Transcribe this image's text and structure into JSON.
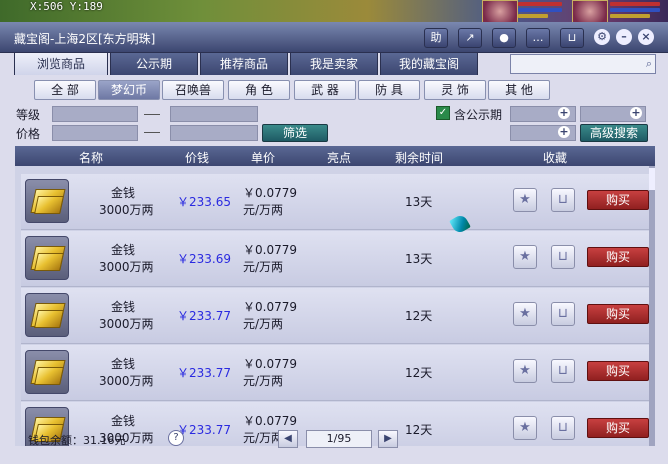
{
  "game_hud": {
    "coords": "X:506 Y:189"
  },
  "window": {
    "title": "藏宝阁-上海2区[东方明珠]",
    "title_buttons": [
      "助",
      "↗"
    ]
  },
  "tabs": [
    {
      "label": "浏览商品",
      "active": true
    },
    {
      "label": "公示期",
      "active": false
    },
    {
      "label": "推荐商品",
      "active": false
    },
    {
      "label": "我是卖家",
      "active": false
    },
    {
      "label": "我的藏宝阁",
      "active": false
    }
  ],
  "search": {
    "value": "",
    "placeholder": ""
  },
  "categories": [
    {
      "label": "全 部",
      "active": false
    },
    {
      "label": "梦幻币",
      "active": true
    },
    {
      "label": "召唤兽",
      "active": false
    },
    {
      "label": "角 色",
      "active": false
    },
    {
      "label": "武 器",
      "active": false
    },
    {
      "label": "防 具",
      "active": false
    },
    {
      "label": "灵 饰",
      "active": false
    },
    {
      "label": "其 他",
      "active": false
    }
  ],
  "filters": {
    "level_label": "等级",
    "price_label": "价格",
    "filter_button": "筛选",
    "include_public_label": "含公示期",
    "include_public_checked": true,
    "advanced_search_button": "高级搜索"
  },
  "table": {
    "headers": [
      "名称",
      "价钱",
      "单价",
      "亮点",
      "剩余时间",
      "收藏"
    ],
    "rows": [
      {
        "name": "金钱",
        "amount": "3000万两",
        "price": "￥233.65",
        "unit_price": "￥0.0779",
        "unit_label": "元/万两",
        "time_left": "13天",
        "buy": "购买"
      },
      {
        "name": "金钱",
        "amount": "3000万两",
        "price": "￥233.69",
        "unit_price": "￥0.0779",
        "unit_label": "元/万两",
        "time_left": "13天",
        "buy": "购买"
      },
      {
        "name": "金钱",
        "amount": "3000万两",
        "price": "￥233.77",
        "unit_price": "￥0.0779",
        "unit_label": "元/万两",
        "time_left": "12天",
        "buy": "购买"
      },
      {
        "name": "金钱",
        "amount": "3000万两",
        "price": "￥233.77",
        "unit_price": "￥0.0779",
        "unit_label": "元/万两",
        "time_left": "12天",
        "buy": "购买"
      },
      {
        "name": "金钱",
        "amount": "3000万两",
        "price": "￥233.77",
        "unit_price": "￥0.0779",
        "unit_label": "元/万两",
        "time_left": "12天",
        "buy": "购买"
      }
    ]
  },
  "footer": {
    "wallet_label": "钱包余额：31.16元",
    "help": "?",
    "page_indicator": "1/95"
  }
}
